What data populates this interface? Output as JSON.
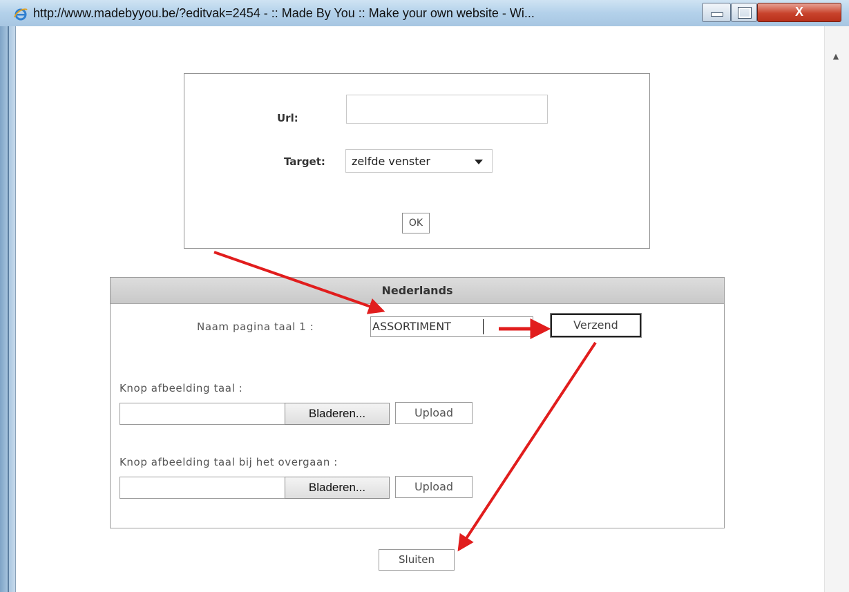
{
  "window": {
    "title": "http://www.madebyyou.be/?editvak=2454 - :: Made By You :: Make your own website - Wi...",
    "browser_icon": "ie-icon",
    "controls": {
      "minimize_icon": "minimize-icon",
      "maximize_icon": "maximize-icon",
      "close_label": "X"
    }
  },
  "link_dialog": {
    "url_label": "Url:",
    "url_value": "",
    "target_label": "Target:",
    "target_selected": "zelfde venster",
    "ok_label": "OK"
  },
  "language_panel": {
    "header": "Nederlands",
    "naam_label": "Naam pagina taal 1 :",
    "naam_value": "ASSORTIMENT",
    "verzend_label": "Verzend",
    "knop_label": "Knop afbeelding taal :",
    "knop_over_label": "Knop afbeelding taal bij het overgaan :",
    "browse_label": "Bladeren...",
    "upload_label": "Upload"
  },
  "sluiten_label": "Sluiten",
  "annotation": {
    "arrow_color": "#e11d1d"
  },
  "colors": {
    "titlebar": "#b3d1ea",
    "panel_header": "#d3d3d3",
    "close_button": "#c8432c"
  }
}
